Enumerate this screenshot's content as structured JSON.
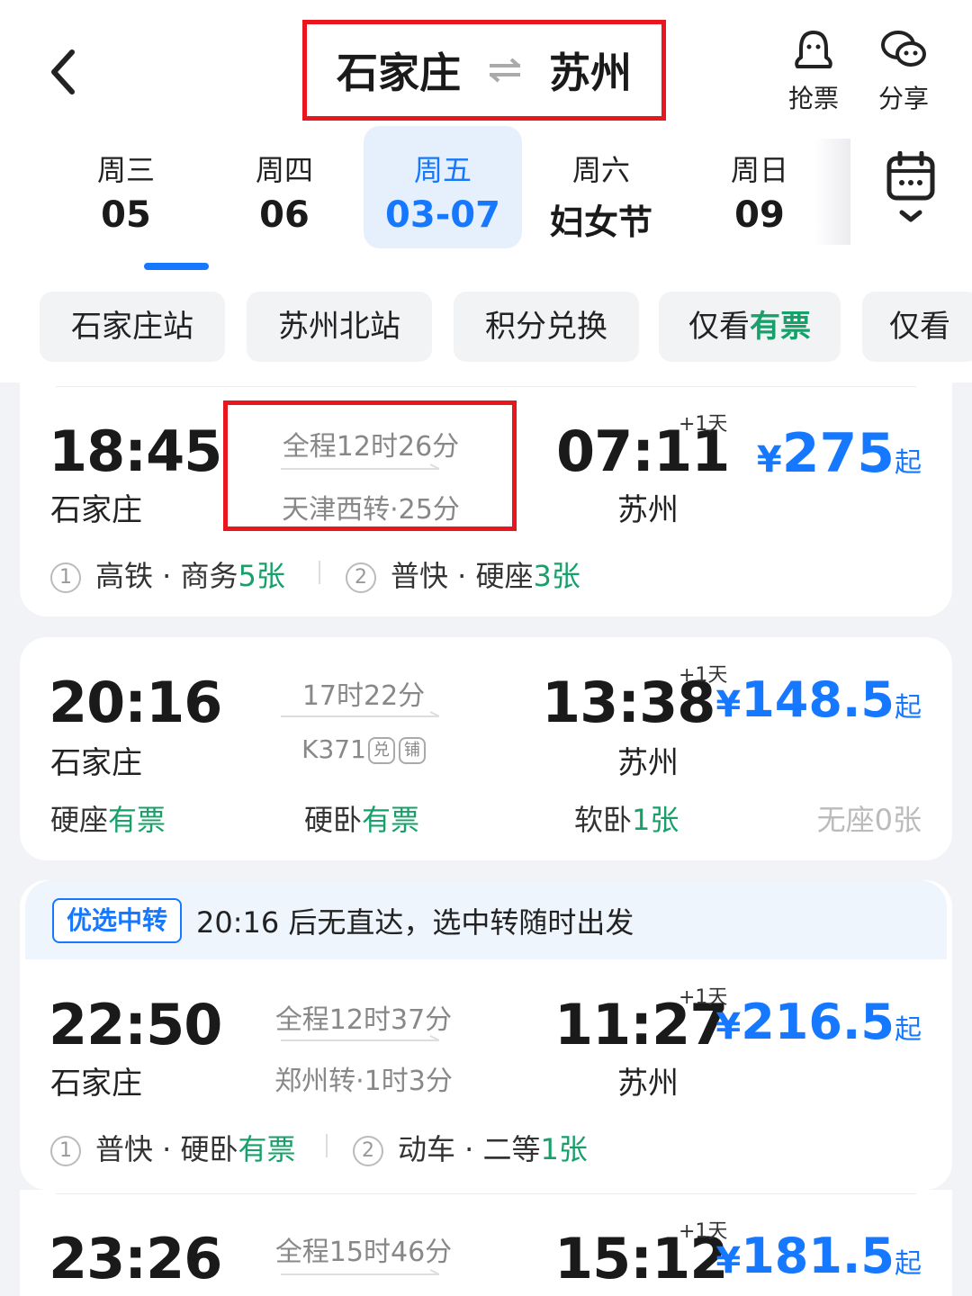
{
  "header": {
    "from": "石家庄",
    "to": "苏州",
    "actions": [
      {
        "label": "抢票",
        "icon": "ghost-icon"
      },
      {
        "label": "分享",
        "icon": "wechat-icon"
      }
    ]
  },
  "dates": [
    {
      "week": "周三",
      "date": "05"
    },
    {
      "week": "周四",
      "date": "06"
    },
    {
      "week": "周五",
      "date": "03-07",
      "active": true
    },
    {
      "week": "周六",
      "date": "妇女节"
    },
    {
      "week": "周日",
      "date": "09"
    }
  ],
  "filters": {
    "f0": "石家庄站",
    "f1": "苏州北站",
    "f2": "积分兑换",
    "f3_prefix": "仅看",
    "f3_green": "有票",
    "f4": "仅看"
  },
  "trains": [
    {
      "depart_time": "18:45",
      "depart_city": "石家庄",
      "duration": "全程12时26分",
      "via": "天津西转·25分",
      "arrive_time": "07:11",
      "arrive_city": "苏州",
      "plus_day": "+1天",
      "price_symbol": "¥",
      "price": "275",
      "price_suffix": "起",
      "seg1_num": "1",
      "seg1_text": "高铁 · 商务",
      "seg1_avail": "5张",
      "seg2_num": "2",
      "seg2_text": "普快 · 硬座",
      "seg2_avail": "3张"
    },
    {
      "depart_time": "20:16",
      "depart_city": "石家庄",
      "duration": "17时22分",
      "train_no": "K371",
      "badge1": "兑",
      "badge2": "铺",
      "arrive_time": "13:38",
      "arrive_city": "苏州",
      "plus_day": "+1天",
      "price_symbol": "¥",
      "price": "148.5",
      "price_suffix": "起",
      "seats": [
        {
          "type": "硬座",
          "avail": "有票"
        },
        {
          "type": "硬卧",
          "avail": "有票"
        },
        {
          "type": "软卧",
          "avail": "1张"
        },
        {
          "type": "无座",
          "avail": "0张"
        }
      ]
    },
    {
      "depart_time": "22:50",
      "depart_city": "石家庄",
      "duration": "全程12时37分",
      "via": "郑州转·1时3分",
      "arrive_time": "11:27",
      "arrive_city": "苏州",
      "plus_day": "+1天",
      "price_symbol": "¥",
      "price": "216.5",
      "price_suffix": "起",
      "seg1_num": "1",
      "seg1_text": "普快 · 硬卧",
      "seg1_avail": "有票",
      "seg2_num": "2",
      "seg2_text": "动车 · 二等",
      "seg2_avail": "1张"
    },
    {
      "depart_time": "23:26",
      "duration": "全程15时46分",
      "arrive_time": "15:12",
      "plus_day": "+1天",
      "price_symbol": "¥",
      "price": "181.5",
      "price_suffix": "起"
    }
  ],
  "promo": {
    "tag": "优选中转",
    "text": "20:16 后无直达，选中转随时出发"
  },
  "colors": {
    "accent": "#1677ff",
    "green": "#17a06a",
    "highlight": "#e8161f"
  }
}
